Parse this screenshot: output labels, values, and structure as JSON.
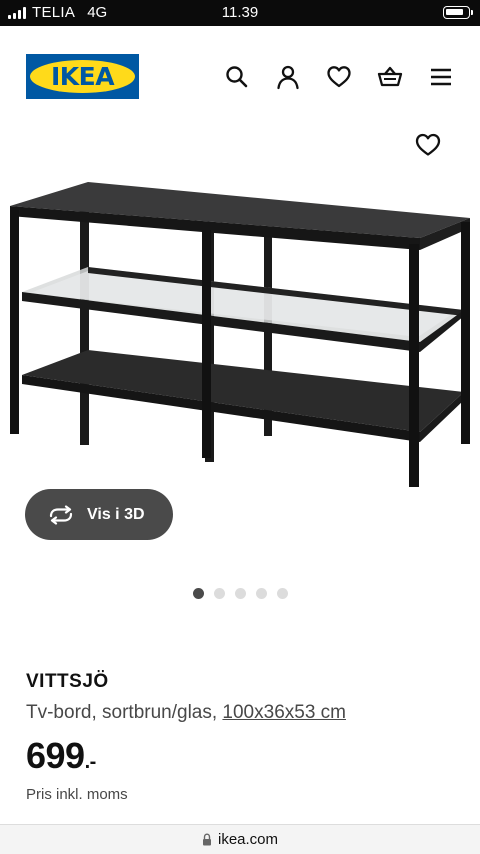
{
  "status_bar": {
    "carrier": "TELIA",
    "network": "4G",
    "time": "11.39",
    "battery_level": 0.85
  },
  "header": {
    "logo_text": "IKEA",
    "brand_colors": {
      "blue": "#0058a3",
      "yellow": "#ffda1a"
    },
    "icons": [
      "search-icon",
      "user-icon",
      "heart-icon",
      "cart-icon",
      "menu-icon"
    ]
  },
  "product": {
    "favorite_icon": "heart-icon",
    "view_3d_label": "Vis i 3D",
    "carousel": {
      "count": 5,
      "active_index": 0
    },
    "name": "VITTSJÖ",
    "description": "Tv-bord, sortbrun/glas,",
    "dimensions": "100x36x53 cm",
    "price": "699",
    "price_suffix": ".-",
    "price_note": "Pris inkl. moms"
  },
  "browser": {
    "url": "ikea.com"
  }
}
